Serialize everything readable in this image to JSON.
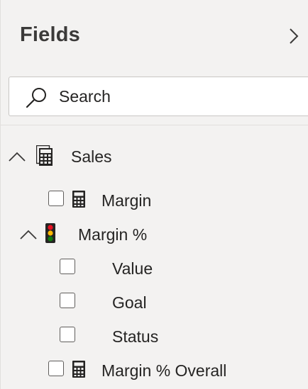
{
  "header": {
    "title": "Fields",
    "collapse_icon": "chevron-right-icon"
  },
  "search": {
    "placeholder": "Search",
    "icon": "search-icon"
  },
  "tree": {
    "table": {
      "label": "Sales",
      "icon": "table-calculator-icon",
      "expanded": true
    },
    "items": [
      {
        "label": "Margin",
        "icon": "calculator-icon",
        "checked": false
      },
      {
        "label": "Margin %",
        "icon": "traffic-light-kpi-icon",
        "expanded": true,
        "children": [
          {
            "label": "Value",
            "checked": false
          },
          {
            "label": "Goal",
            "checked": false
          },
          {
            "label": "Status",
            "checked": false
          }
        ]
      },
      {
        "label": "Margin % Overall",
        "icon": "calculator-icon",
        "checked": false
      }
    ]
  },
  "colors": {
    "pane_background": "#f3f2f1",
    "text": "#252423",
    "kpi_red": "#e81123",
    "kpi_yellow": "#ffb900",
    "kpi_green": "#107c10"
  }
}
